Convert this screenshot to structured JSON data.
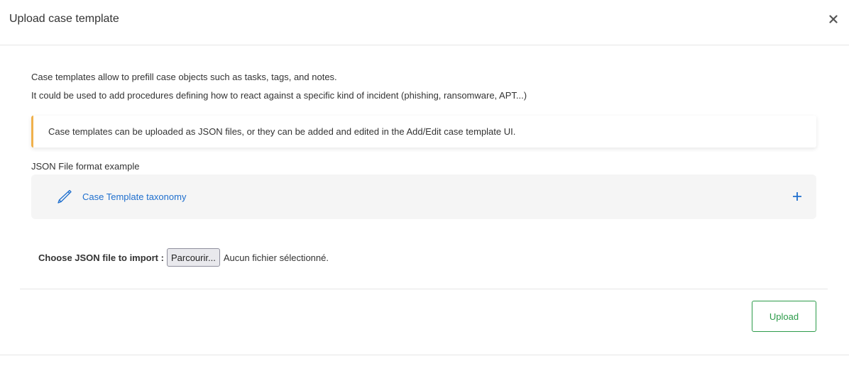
{
  "modal": {
    "title": "Upload case template",
    "close_icon": "close-icon"
  },
  "intro": {
    "line1": "Case templates allow to prefill case objects such as tasks, tags, and notes.",
    "line2": "It could be used to add procedures defining how to react against a specific kind of incident (phishing, ransomware, APT...)"
  },
  "callout": {
    "text": "Case templates can be uploaded as JSON files, or they can be added and edited in the Add/Edit case template UI.",
    "accent_color": "#f0b14c"
  },
  "json_example": {
    "label": "JSON File format example",
    "accordion_title": "Case Template taxonomy",
    "accordion_icon": "pencil-icon",
    "expand_icon": "plus-icon",
    "link_color": "#1f6fce"
  },
  "file_import": {
    "label": "Choose JSON file to import :",
    "browse_label": "Parcourir...",
    "status": "Aucun fichier sélectionné."
  },
  "footer": {
    "upload_label": "Upload",
    "upload_color": "#2c9b4a"
  }
}
